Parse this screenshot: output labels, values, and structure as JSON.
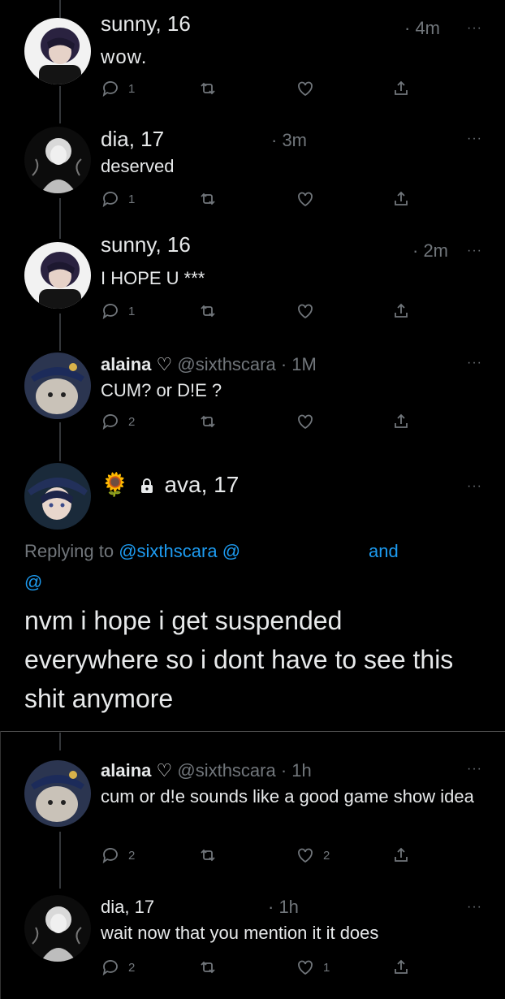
{
  "tweets": [
    {
      "name": "sunny, 16",
      "time": "· 4m",
      "text": "wow.",
      "replies": "1",
      "retweets": "",
      "likes": "",
      "more": "···"
    },
    {
      "name": "dia, 17",
      "time": "· 3m",
      "text": "deserved",
      "replies": "1",
      "retweets": "",
      "likes": "",
      "more": "···"
    },
    {
      "name": "sunny, 16",
      "time": "· 2m",
      "text": "I HOPE U ***",
      "replies": "1",
      "retweets": "",
      "likes": "",
      "more": "···"
    },
    {
      "name": "alaina",
      "handle": "@sixthscara",
      "time": "· 1M",
      "text": "CUM? or D!E ?",
      "replies": "2",
      "retweets": "",
      "likes": "",
      "more": "···"
    }
  ],
  "main_tweet": {
    "emoji": "🌻",
    "name": "ava, 17",
    "replying_prefix": "Replying to",
    "replying_handle1": "@sixthscara",
    "replying_handle2": "@",
    "replying_and": "and",
    "replying_handle3": "@",
    "text": "nvm i hope i get suspended everywhere so i dont have to see this shit anymore",
    "more": "···"
  },
  "replies": [
    {
      "name": "alaina",
      "handle": "@sixthscara",
      "time": "· 1h",
      "text": "cum or d!e sounds like a good game show idea",
      "replies": "2",
      "retweets": "",
      "likes": "2",
      "more": "···"
    },
    {
      "name": "dia, 17",
      "time": "· 1h",
      "text": "wait now that you mention it it does",
      "replies": "2",
      "retweets": "",
      "likes": "1",
      "more": "···"
    }
  ],
  "colors": {
    "background": "#000000",
    "text": "#e7e9ea",
    "muted": "#71767b",
    "link": "#1d9bf0"
  }
}
